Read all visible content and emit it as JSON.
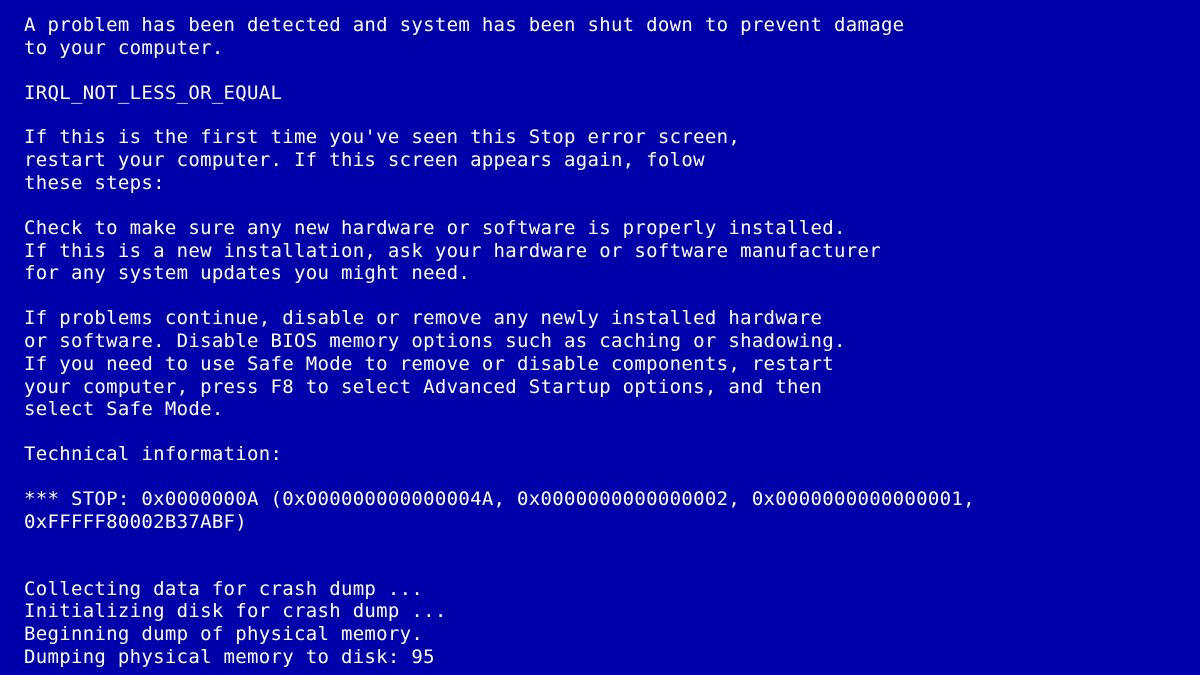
{
  "bsod": {
    "header": "A problem has been detected and system has been shut down to prevent damage\nto your computer.",
    "error_code": "IRQL_NOT_LESS_OR_EQUAL",
    "first_time": "If this is the first time you've seen this Stop error screen,\nrestart your computer. If this screen appears again, folow\nthese steps:",
    "check_hw": "Check to make sure any new hardware or software is properly installed.\nIf this is a new installation, ask your hardware or software manufacturer\nfor any system updates you might need.",
    "if_problems": "If problems continue, disable or remove any newly installed hardware\nor software. Disable BIOS memory options such as caching or shadowing.\nIf you need to use Safe Mode to remove or disable components, restart\nyour computer, press F8 to select Advanced Startup options, and then\nselect Safe Mode.",
    "tech_info_label": "Technical information:",
    "stop_line": "*** STOP: 0x0000000A (0x000000000000004A, 0x0000000000000002, 0x0000000000000001,\n0xFFFFF80002B37ABF)",
    "dump_status": "Collecting data for crash dump ...\nInitializing disk for crash dump ...\nBeginning dump of physical memory.\nDumping physical memory to disk: 95"
  }
}
